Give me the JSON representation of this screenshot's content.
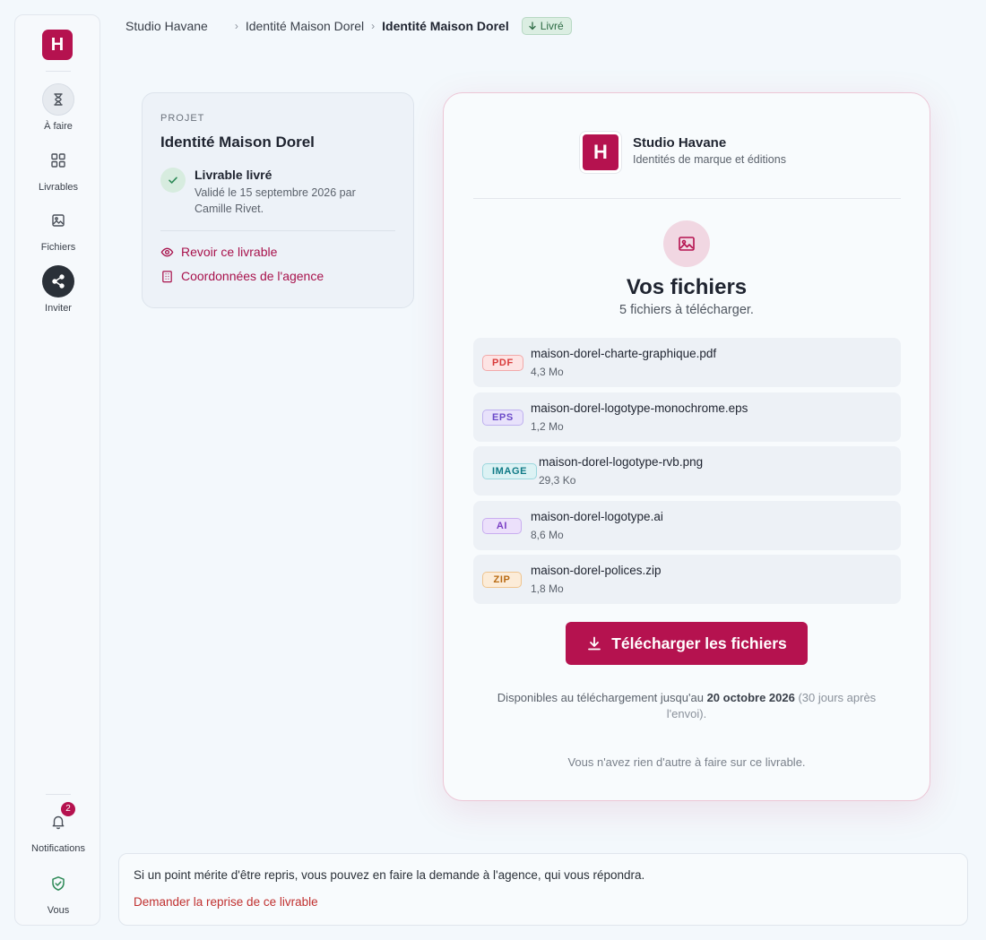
{
  "app": {
    "logo_letter": "H"
  },
  "sidebar": {
    "items": [
      {
        "label": "À faire",
        "icon": "hourglass-icon"
      },
      {
        "label": "Livrables",
        "icon": "grid-icon"
      },
      {
        "label": "Fichiers",
        "icon": "image-icon"
      },
      {
        "label": "Inviter",
        "icon": "share-icon"
      }
    ],
    "notifications": {
      "label": "Notifications",
      "count": "2",
      "icon": "bell-icon"
    },
    "profile": {
      "label": "Vous",
      "icon": "shield-check-icon"
    }
  },
  "breadcrumb": {
    "items": [
      "Studio Havane",
      "Identité Maison Dorel"
    ],
    "current": "Identité Maison Dorel",
    "status": "Livré"
  },
  "project": {
    "eyebrow": "PROJET",
    "title": "Identité Maison Dorel",
    "deliverable_status": "Livrable livré",
    "validated": "Validé le 15 septembre 2026 par Camille Rivet.",
    "links": [
      "Revoir ce livrable",
      "Coordonnées de l'agence"
    ]
  },
  "agency": {
    "logo_letter": "H",
    "name": "Studio Havane",
    "tagline": "Identités de marque et éditions"
  },
  "files": {
    "title": "Vos fichiers",
    "count_text": "5 fichiers à télécharger.",
    "items": [
      {
        "type": "PDF",
        "name": "maison-dorel-charte-graphique.pdf",
        "size": "4,3 Mo"
      },
      {
        "type": "EPS",
        "name": "maison-dorel-logotype-monochrome.eps",
        "size": "1,2 Mo"
      },
      {
        "type": "IMAGE",
        "name": "maison-dorel-logotype-rvb.png",
        "size": "29,3 Ko"
      },
      {
        "type": "AI",
        "name": "maison-dorel-logotype.ai",
        "size": "8,6 Mo"
      },
      {
        "type": "ZIP",
        "name": "maison-dorel-polices.zip",
        "size": "1,8 Mo"
      }
    ],
    "download_label": "Télécharger les fichiers",
    "availability_prefix": "Disponibles au téléchargement jusqu'au",
    "availability_date": "20 octobre 2026",
    "availability_suffix": "(30 jours après l'envoi).",
    "nothing_left": "Vous n'avez rien d'autre à faire sur ce livrable."
  },
  "banner": {
    "text": "Si un point mérite d'être repris, vous pouvez en faire la demande à l'agence, qui vous répondra.",
    "link": "Demander la reprise de ce livrable"
  },
  "colors": {
    "brand": "#b5124f",
    "success": "#2d6b44",
    "tag_pdf": "#d93a3a",
    "tag_eps": "#6b49c9",
    "tag_image": "#0f7a86",
    "tag_ai": "#7a3fc4",
    "tag_zip": "#b86a12"
  }
}
